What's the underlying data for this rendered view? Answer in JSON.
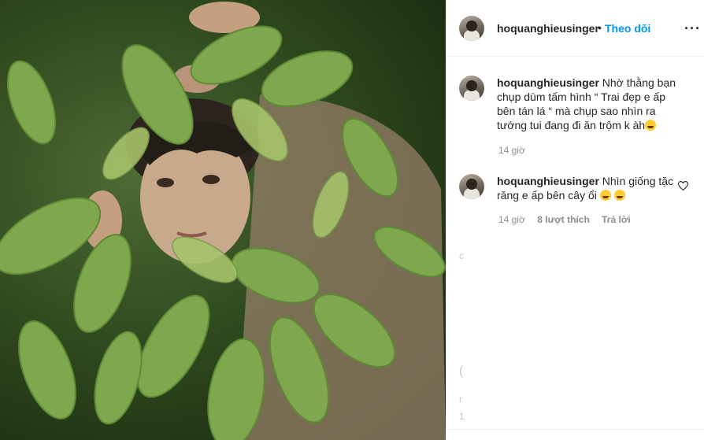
{
  "post": {
    "username": "hoquanghieusinger",
    "dot": "•",
    "follow_label": "Theo dõi",
    "more_label": "···"
  },
  "comments": [
    {
      "username": "hoquanghieusinger",
      "text": "Nhờ thằng bạn chụp dùm tấm hình “ Trai đẹp e ấp bên tán lá “ mà chụp sao nhìn ra tướng tui đang đi ăn trộm k àh",
      "emoji": "😅",
      "time": "14 giờ"
    },
    {
      "username": "hoquanghieusinger",
      "text": "Nhìn giống tặc răng e ấp bên cây ổi",
      "emoji": "🤣🤣",
      "time": "14 giờ",
      "likes": "8 lượt thích",
      "reply": "Trả lời"
    }
  ],
  "icons": {
    "more": "more-icon",
    "heart": "heart-icon"
  }
}
